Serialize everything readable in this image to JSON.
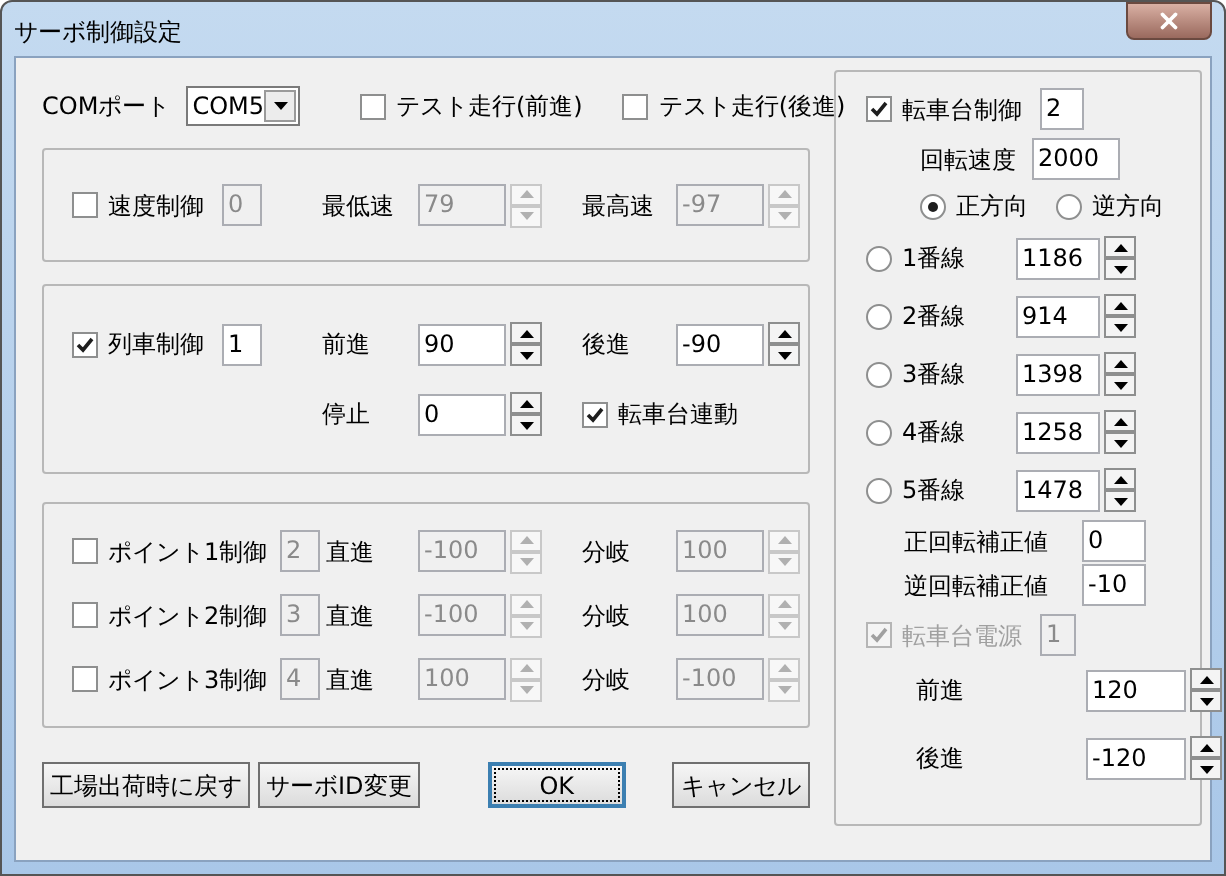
{
  "window": {
    "title": "サーボ制御設定"
  },
  "com_port": {
    "label": "COMポート",
    "value": "COM5"
  },
  "test_run": [
    {
      "label": "テスト走行(前進)",
      "checked": false
    },
    {
      "label": "テスト走行(後進)",
      "checked": false
    }
  ],
  "speed_control": {
    "label": "速度制御",
    "checked": false,
    "id": "0",
    "min_label": "最低速",
    "min_value": "79",
    "max_label": "最高速",
    "max_value": "-97"
  },
  "train_control": {
    "label": "列車制御",
    "checked": true,
    "id": "1",
    "forward_label": "前進",
    "forward": "90",
    "reverse_label": "後進",
    "reverse": "-90",
    "stop_label": "停止",
    "stop": "0",
    "turntable_link": {
      "label": "転車台連動",
      "checked": true
    }
  },
  "points": [
    {
      "label": "ポイント1制御",
      "checked": false,
      "id": "2",
      "straight_label": "直進",
      "straight": "-100",
      "branch_label": "分岐",
      "branch": "100"
    },
    {
      "label": "ポイント2制御",
      "checked": false,
      "id": "3",
      "straight_label": "直進",
      "straight": "-100",
      "branch_label": "分岐",
      "branch": "100"
    },
    {
      "label": "ポイント3制御",
      "checked": false,
      "id": "4",
      "straight_label": "直進",
      "straight": "100",
      "branch_label": "分岐",
      "branch": "-100"
    }
  ],
  "buttons": [
    {
      "label": "工場出荷時に戻す",
      "focused": false
    },
    {
      "label": "サーボID変更",
      "focused": false
    },
    {
      "label": "OK",
      "focused": true
    },
    {
      "label": "キャンセル",
      "focused": false
    }
  ],
  "turntable": {
    "label": "転車台制御",
    "checked": true,
    "id": "2",
    "speed_label": "回転速度",
    "speed": "2000",
    "directions": [
      {
        "label": "正方向",
        "selected": true
      },
      {
        "label": "逆方向",
        "selected": false
      }
    ],
    "tracks": [
      {
        "label": "1番線",
        "selected": false,
        "value": "1186"
      },
      {
        "label": "2番線",
        "selected": false,
        "value": "914"
      },
      {
        "label": "3番線",
        "selected": false,
        "value": "1398"
      },
      {
        "label": "4番線",
        "selected": false,
        "value": "1258"
      },
      {
        "label": "5番線",
        "selected": false,
        "value": "1478"
      }
    ],
    "cw_correction": {
      "label": "正回転補正値",
      "value": "0"
    },
    "ccw_correction": {
      "label": "逆回転補正値",
      "value": "-10"
    },
    "power": {
      "label": "転車台電源",
      "checked": true,
      "disabled": true,
      "id": "1",
      "forward_label": "前進",
      "forward": "120",
      "reverse_label": "後進",
      "reverse": "-120"
    }
  }
}
